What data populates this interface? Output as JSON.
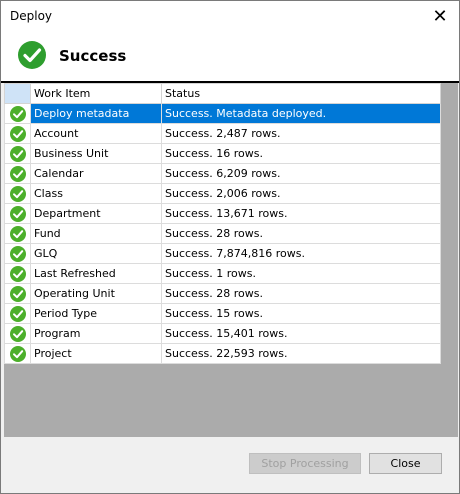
{
  "window": {
    "title": "Deploy"
  },
  "banner": {
    "text": "Success",
    "icon": "check-circle-icon",
    "icon_color": "#2e9e2e"
  },
  "grid": {
    "headers": [
      "Work Item",
      "Status"
    ],
    "rows": [
      {
        "item": "Deploy metadata",
        "status": "Success. Metadata deployed.",
        "selected": true
      },
      {
        "item": "Account",
        "status": "Success. 2,487 rows."
      },
      {
        "item": "Business Unit",
        "status": "Success. 16 rows."
      },
      {
        "item": "Calendar",
        "status": "Success. 6,209 rows."
      },
      {
        "item": "Class",
        "status": "Success. 2,006 rows."
      },
      {
        "item": "Department",
        "status": "Success. 13,671 rows."
      },
      {
        "item": "Fund",
        "status": "Success. 28 rows."
      },
      {
        "item": "GLQ",
        "status": "Success. 7,874,816 rows."
      },
      {
        "item": "Last Refreshed",
        "status": "Success. 1 rows."
      },
      {
        "item": "Operating Unit",
        "status": "Success. 28 rows."
      },
      {
        "item": "Period Type",
        "status": "Success. 15 rows."
      },
      {
        "item": "Program",
        "status": "Success. 15,401 rows."
      },
      {
        "item": "Project",
        "status": "Success. 22,593 rows."
      }
    ],
    "selection_color": "#0078d7"
  },
  "buttons": {
    "stop": "Stop Processing",
    "close": "Close"
  }
}
